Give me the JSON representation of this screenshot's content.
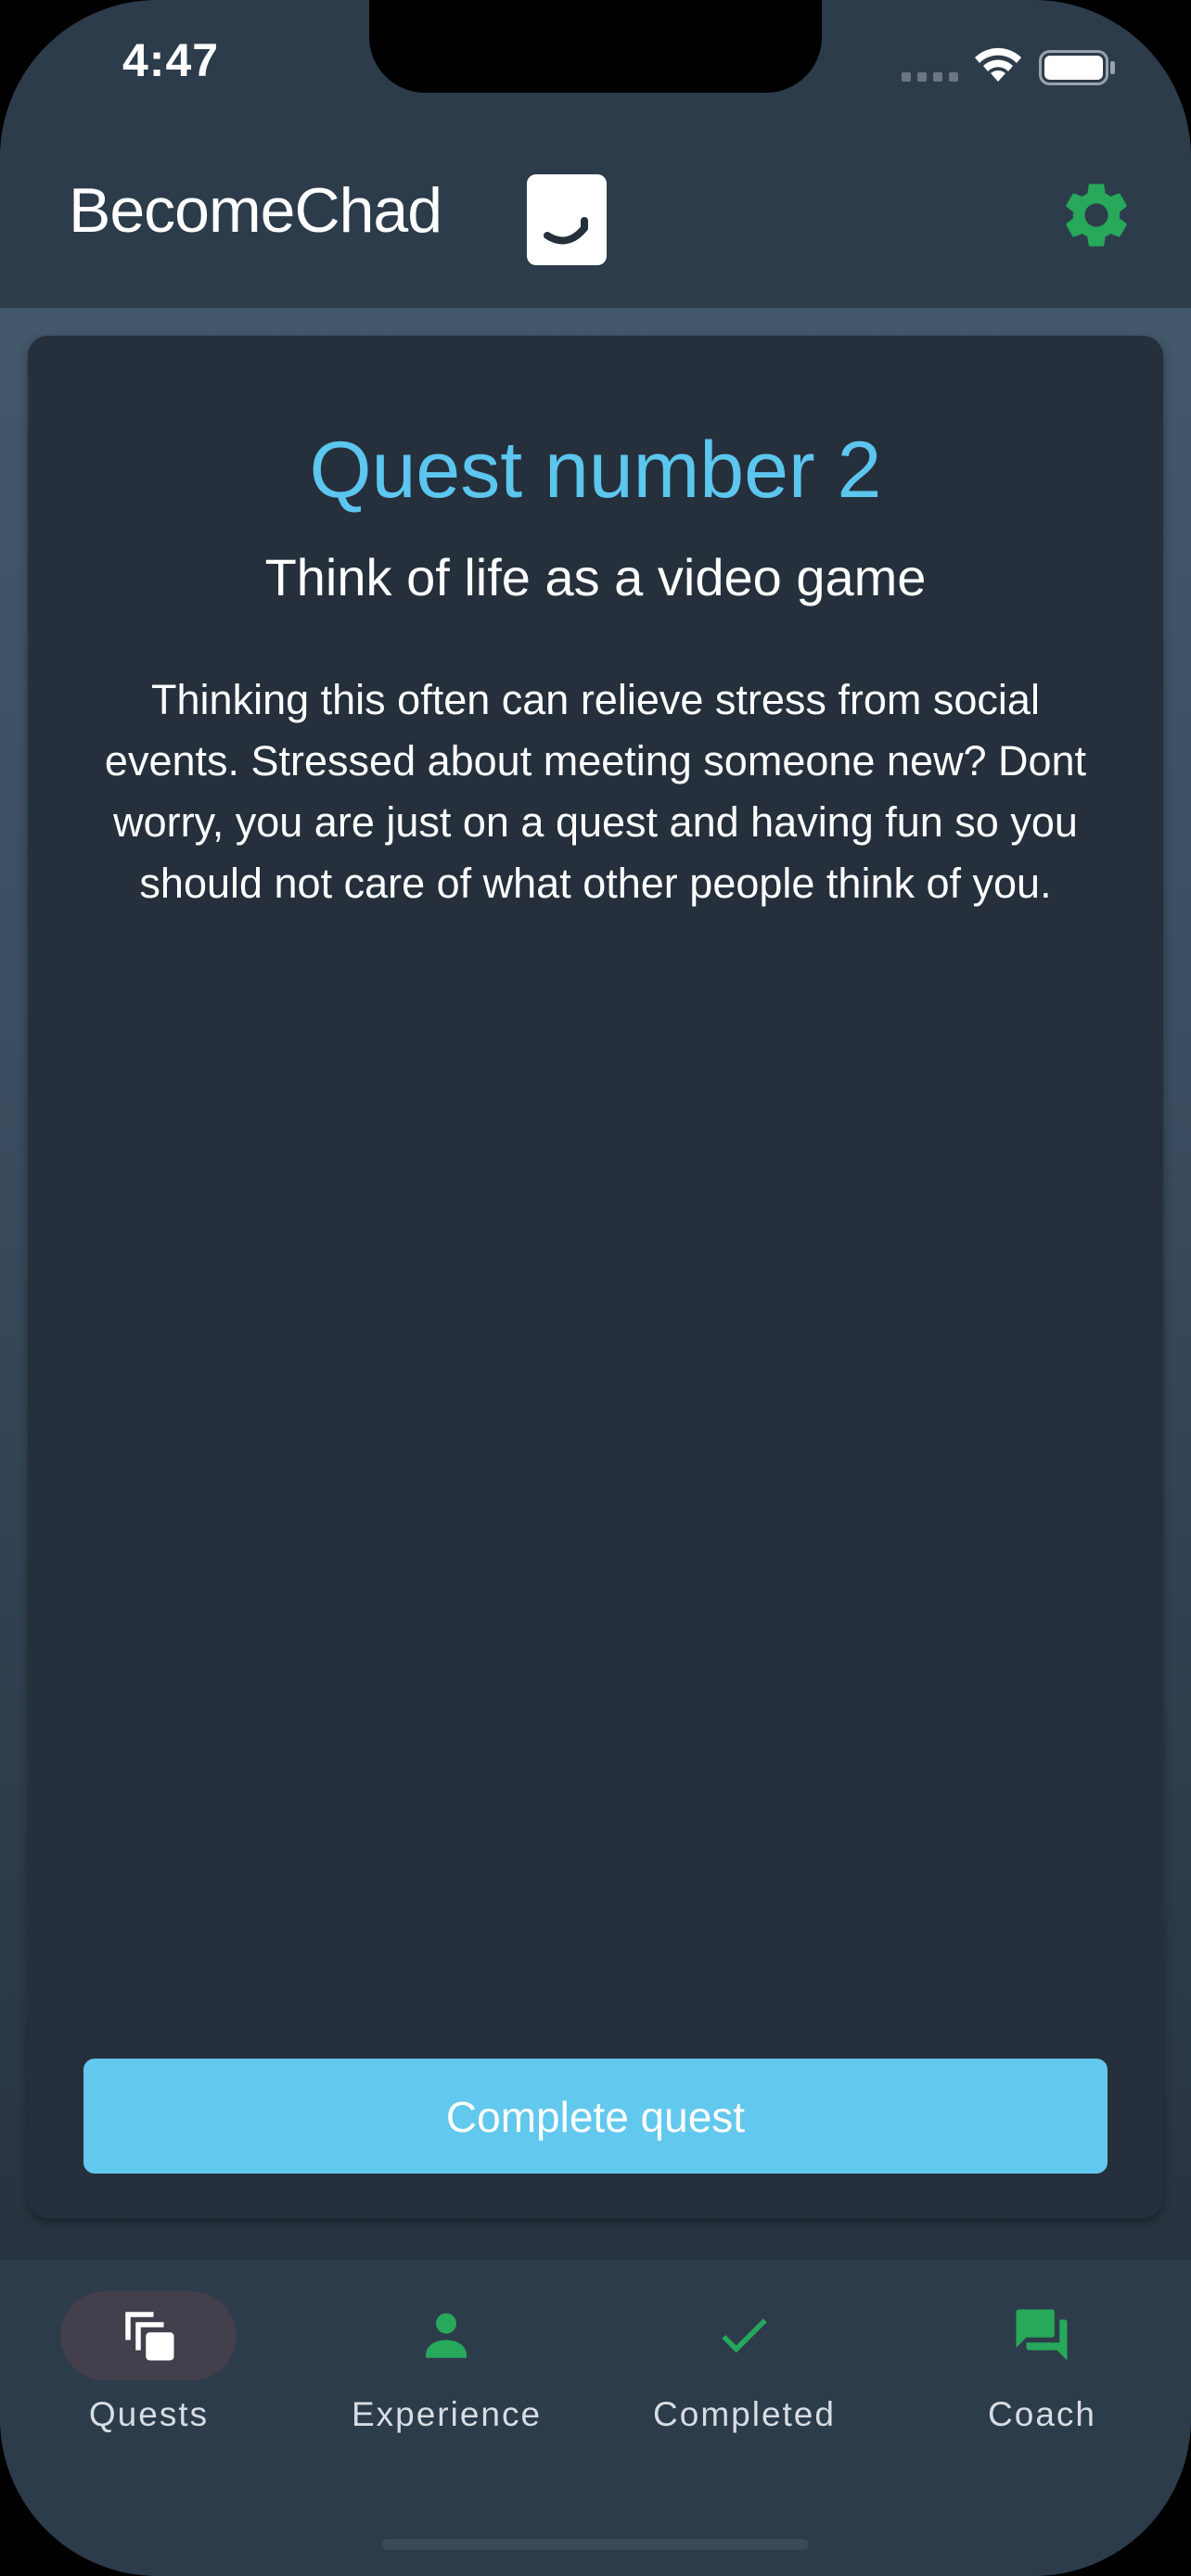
{
  "status_bar": {
    "time": "4:47"
  },
  "header": {
    "brand": "BecomeChad",
    "settings_icon": "gear-icon",
    "accent_color": "#27a85a"
  },
  "quest": {
    "title": "Quest number 2",
    "subtitle": "Think of life as a video game",
    "description": "Thinking this often can relieve stress from social events. Stressed about meeting someone new? Dont worry, you are just on a quest and having fun so you should not care of what other people think of you.",
    "complete_label": "Complete quest",
    "title_color": "#5cc6ee",
    "button_color": "#62c8ee"
  },
  "bottom_nav": {
    "items": [
      {
        "label": "Quests",
        "icon": "stacked-cards-icon",
        "selected": true
      },
      {
        "label": "Experience",
        "icon": "person-icon",
        "selected": false
      },
      {
        "label": "Completed",
        "icon": "check-icon",
        "selected": false
      },
      {
        "label": "Coach",
        "icon": "chat-icon",
        "selected": false
      }
    ]
  }
}
